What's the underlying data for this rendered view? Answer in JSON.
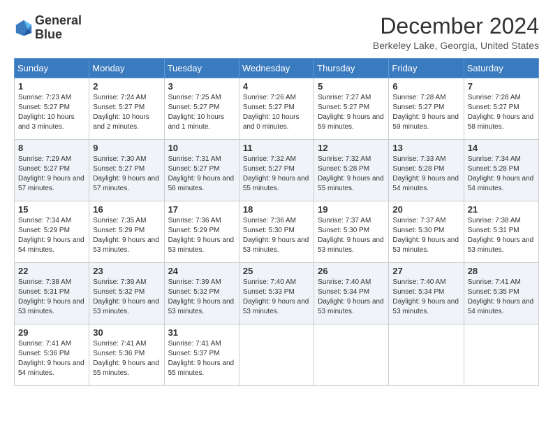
{
  "header": {
    "logo_line1": "General",
    "logo_line2": "Blue",
    "month_title": "December 2024",
    "location": "Berkeley Lake, Georgia, United States"
  },
  "weekdays": [
    "Sunday",
    "Monday",
    "Tuesday",
    "Wednesday",
    "Thursday",
    "Friday",
    "Saturday"
  ],
  "weeks": [
    [
      {
        "day": "1",
        "sunrise": "7:23 AM",
        "sunset": "5:27 PM",
        "daylight": "10 hours and 3 minutes."
      },
      {
        "day": "2",
        "sunrise": "7:24 AM",
        "sunset": "5:27 PM",
        "daylight": "10 hours and 2 minutes."
      },
      {
        "day": "3",
        "sunrise": "7:25 AM",
        "sunset": "5:27 PM",
        "daylight": "10 hours and 1 minute."
      },
      {
        "day": "4",
        "sunrise": "7:26 AM",
        "sunset": "5:27 PM",
        "daylight": "10 hours and 0 minutes."
      },
      {
        "day": "5",
        "sunrise": "7:27 AM",
        "sunset": "5:27 PM",
        "daylight": "9 hours and 59 minutes."
      },
      {
        "day": "6",
        "sunrise": "7:28 AM",
        "sunset": "5:27 PM",
        "daylight": "9 hours and 59 minutes."
      },
      {
        "day": "7",
        "sunrise": "7:28 AM",
        "sunset": "5:27 PM",
        "daylight": "9 hours and 58 minutes."
      }
    ],
    [
      {
        "day": "8",
        "sunrise": "7:29 AM",
        "sunset": "5:27 PM",
        "daylight": "9 hours and 57 minutes."
      },
      {
        "day": "9",
        "sunrise": "7:30 AM",
        "sunset": "5:27 PM",
        "daylight": "9 hours and 57 minutes."
      },
      {
        "day": "10",
        "sunrise": "7:31 AM",
        "sunset": "5:27 PM",
        "daylight": "9 hours and 56 minutes."
      },
      {
        "day": "11",
        "sunrise": "7:32 AM",
        "sunset": "5:27 PM",
        "daylight": "9 hours and 55 minutes."
      },
      {
        "day": "12",
        "sunrise": "7:32 AM",
        "sunset": "5:28 PM",
        "daylight": "9 hours and 55 minutes."
      },
      {
        "day": "13",
        "sunrise": "7:33 AM",
        "sunset": "5:28 PM",
        "daylight": "9 hours and 54 minutes."
      },
      {
        "day": "14",
        "sunrise": "7:34 AM",
        "sunset": "5:28 PM",
        "daylight": "9 hours and 54 minutes."
      }
    ],
    [
      {
        "day": "15",
        "sunrise": "7:34 AM",
        "sunset": "5:29 PM",
        "daylight": "9 hours and 54 minutes."
      },
      {
        "day": "16",
        "sunrise": "7:35 AM",
        "sunset": "5:29 PM",
        "daylight": "9 hours and 53 minutes."
      },
      {
        "day": "17",
        "sunrise": "7:36 AM",
        "sunset": "5:29 PM",
        "daylight": "9 hours and 53 minutes."
      },
      {
        "day": "18",
        "sunrise": "7:36 AM",
        "sunset": "5:30 PM",
        "daylight": "9 hours and 53 minutes."
      },
      {
        "day": "19",
        "sunrise": "7:37 AM",
        "sunset": "5:30 PM",
        "daylight": "9 hours and 53 minutes."
      },
      {
        "day": "20",
        "sunrise": "7:37 AM",
        "sunset": "5:30 PM",
        "daylight": "9 hours and 53 minutes."
      },
      {
        "day": "21",
        "sunrise": "7:38 AM",
        "sunset": "5:31 PM",
        "daylight": "9 hours and 53 minutes."
      }
    ],
    [
      {
        "day": "22",
        "sunrise": "7:38 AM",
        "sunset": "5:31 PM",
        "daylight": "9 hours and 53 minutes."
      },
      {
        "day": "23",
        "sunrise": "7:39 AM",
        "sunset": "5:32 PM",
        "daylight": "9 hours and 53 minutes."
      },
      {
        "day": "24",
        "sunrise": "7:39 AM",
        "sunset": "5:32 PM",
        "daylight": "9 hours and 53 minutes."
      },
      {
        "day": "25",
        "sunrise": "7:40 AM",
        "sunset": "5:33 PM",
        "daylight": "9 hours and 53 minutes."
      },
      {
        "day": "26",
        "sunrise": "7:40 AM",
        "sunset": "5:34 PM",
        "daylight": "9 hours and 53 minutes."
      },
      {
        "day": "27",
        "sunrise": "7:40 AM",
        "sunset": "5:34 PM",
        "daylight": "9 hours and 53 minutes."
      },
      {
        "day": "28",
        "sunrise": "7:41 AM",
        "sunset": "5:35 PM",
        "daylight": "9 hours and 54 minutes."
      }
    ],
    [
      {
        "day": "29",
        "sunrise": "7:41 AM",
        "sunset": "5:36 PM",
        "daylight": "9 hours and 54 minutes."
      },
      {
        "day": "30",
        "sunrise": "7:41 AM",
        "sunset": "5:36 PM",
        "daylight": "9 hours and 55 minutes."
      },
      {
        "day": "31",
        "sunrise": "7:41 AM",
        "sunset": "5:37 PM",
        "daylight": "9 hours and 55 minutes."
      },
      null,
      null,
      null,
      null
    ]
  ],
  "labels": {
    "sunrise": "Sunrise: ",
    "sunset": "Sunset: ",
    "daylight": "Daylight: "
  }
}
